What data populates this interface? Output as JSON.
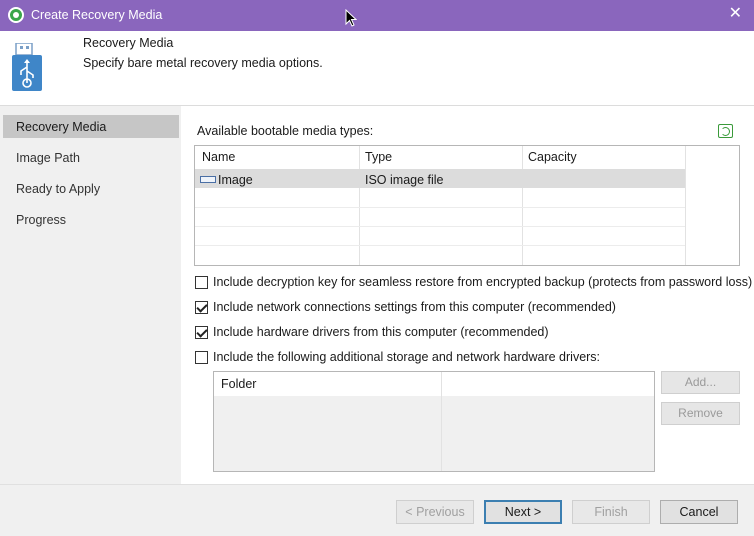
{
  "window": {
    "title": "Create Recovery Media",
    "close_glyph": "✕"
  },
  "header": {
    "title": "Recovery Media",
    "subtitle": "Specify bare metal recovery media options."
  },
  "sidebar": {
    "items": [
      {
        "label": "Recovery Media",
        "active": true
      },
      {
        "label": "Image Path",
        "active": false
      },
      {
        "label": "Ready to Apply",
        "active": false
      },
      {
        "label": "Progress",
        "active": false
      }
    ]
  },
  "media": {
    "label": "Available bootable media types:",
    "columns": [
      "Name",
      "Type",
      "Capacity"
    ],
    "rows": [
      {
        "name": "Image",
        "type": "ISO image file",
        "capacity": ""
      }
    ]
  },
  "options": [
    {
      "label": "Include decryption key for seamless restore from encrypted backup (protects from password loss)",
      "checked": false
    },
    {
      "label": "Include network connections settings from this computer (recommended)",
      "checked": true
    },
    {
      "label": "Include hardware drivers from this computer (recommended)",
      "checked": true
    },
    {
      "label": "Include the following additional storage and network hardware drivers:",
      "checked": false
    }
  ],
  "drivers": {
    "column": "Folder",
    "add_label": "Add...",
    "remove_label": "Remove"
  },
  "footer": {
    "previous_label": "< Previous",
    "next_label": "Next >",
    "finish_label": "Finish",
    "cancel_label": "Cancel"
  },
  "colors": {
    "titlebar": "#8a66bd",
    "accent_green": "#3aa64a",
    "selection": "#c6c6c6"
  },
  "icons": [
    "app-logo-icon",
    "close-icon",
    "usb-drive-icon",
    "refresh-icon",
    "image-file-icon",
    "mouse-cursor-icon"
  ]
}
